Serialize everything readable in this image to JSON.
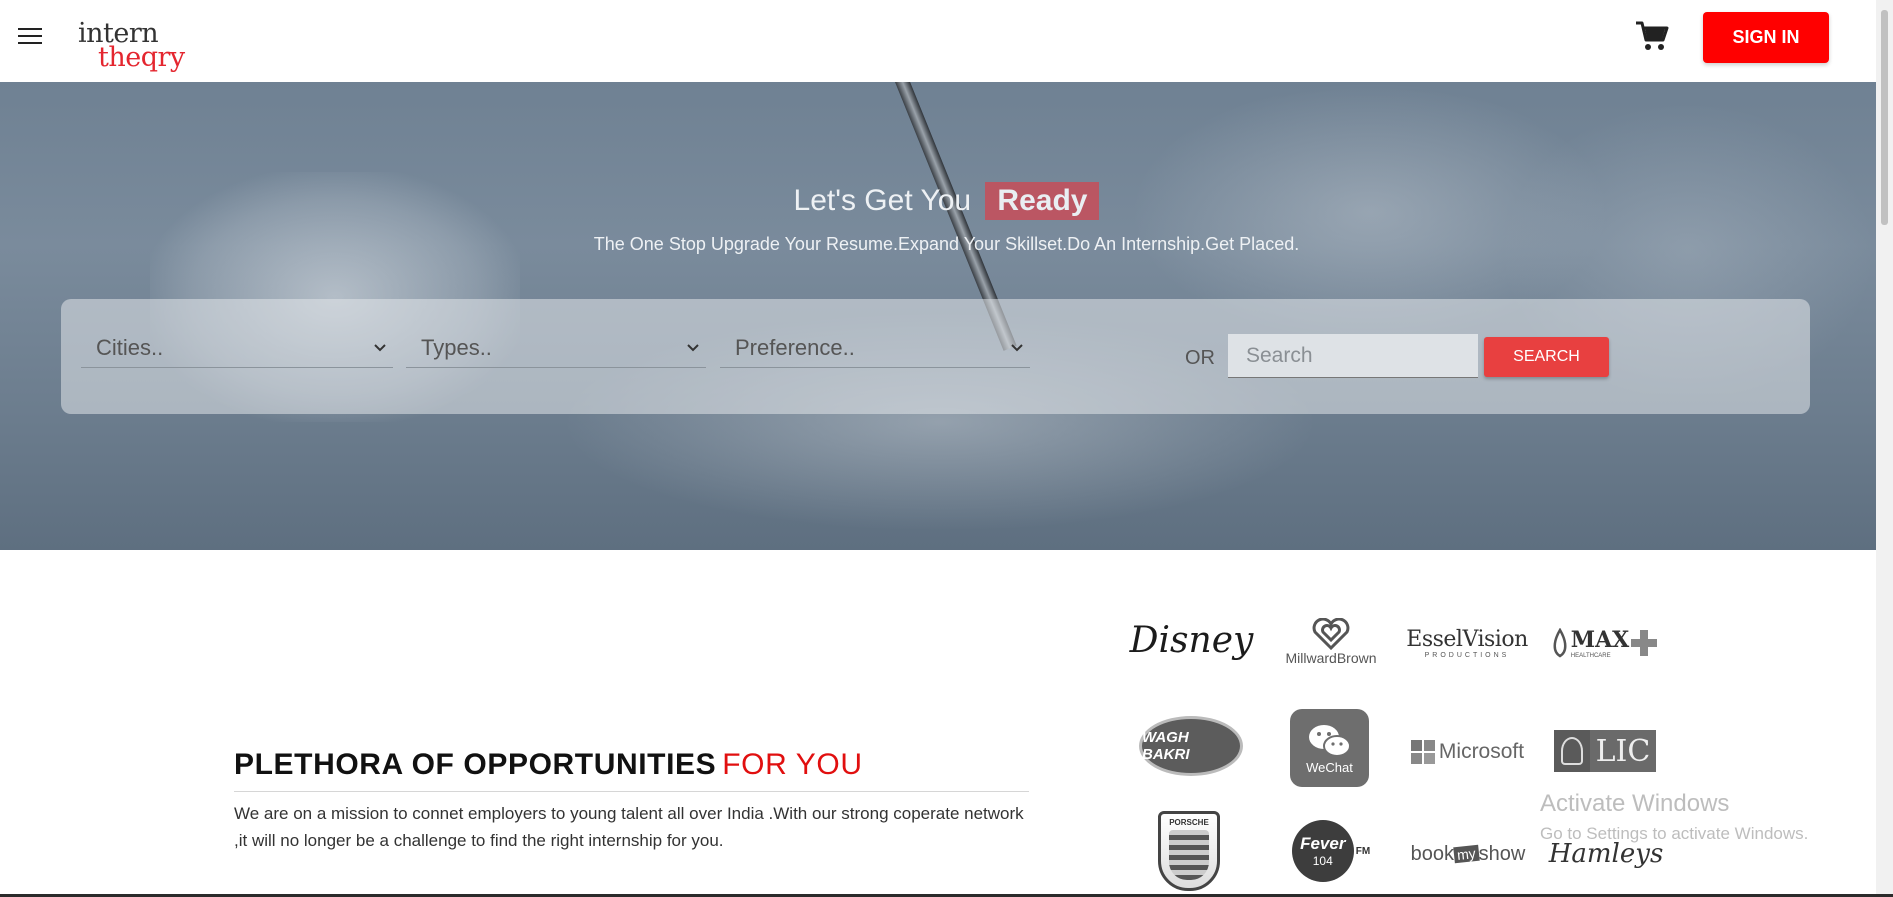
{
  "header": {
    "logo_line1": "intern",
    "logo_line2": "theqry",
    "signin_label": "SIGN IN",
    "icons": [
      "hamburger-menu-icon",
      "cart-icon"
    ]
  },
  "hero": {
    "title_prefix": "Let's Get You",
    "title_highlight": "Ready",
    "subtitle": "The One Stop Upgrade Your Resume.Expand Your Skillset.Do An Internship.Get Placed.",
    "filters": {
      "cities": "Cities..",
      "types": "Types..",
      "preference": "Preference.."
    },
    "or_label": "OR",
    "search_placeholder": "Search",
    "search_button": "SEARCH"
  },
  "opportunities": {
    "headline": "PLETHORA OF OPPORTUNITIES",
    "headline_highlight": "FOR YOU",
    "description": "We are on a mission to connet employers to young talent all over India .With our strong coperate network ,it will no longer be a challenge to find the right internship for you."
  },
  "partners": {
    "disney": "Disney",
    "millward": "MillwardBrown",
    "essel": "EsselVision",
    "essel_sub": "PRODUCTIONS",
    "max": "MAX",
    "max_sub": "HEALTHCARE",
    "wagh": "WAGH BAKRI",
    "wechat": "WeChat",
    "microsoft": "Microsoft",
    "lic": "LIC",
    "porsche": "PORSCHE",
    "fever": "Fever",
    "fever_num": "104",
    "fever_fm": "FM",
    "bookmyshow_book": "book",
    "bookmyshow_my": "my",
    "bookmyshow_show": "show",
    "hamleys": "Hamleys"
  },
  "watermark": {
    "title": "Activate Windows",
    "subtitle": "Go to Settings to activate Windows."
  }
}
